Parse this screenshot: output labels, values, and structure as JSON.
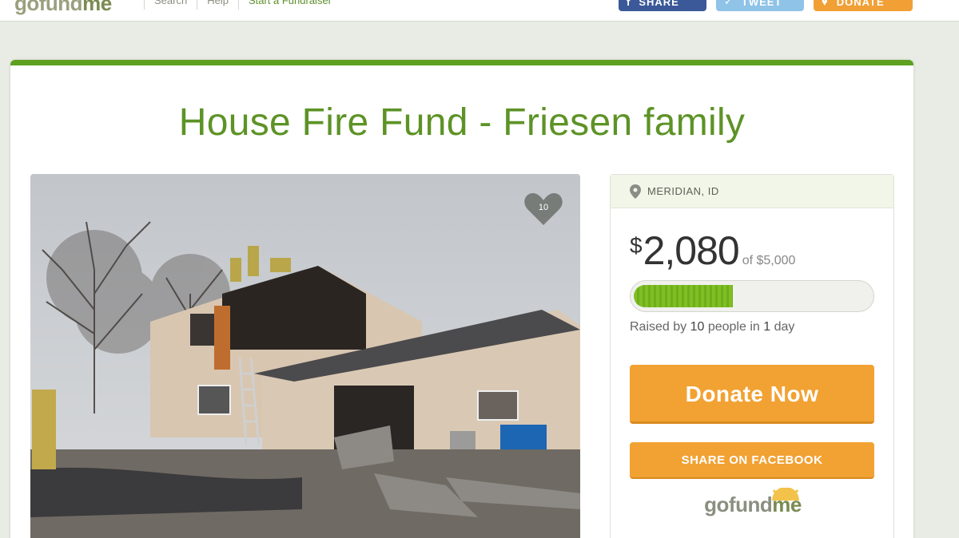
{
  "header": {
    "logo_prefix": "gofund",
    "logo_suffix": "me",
    "nav": [
      "Search",
      "Help",
      "Start a Fundraiser"
    ],
    "share_label": "SHARE",
    "tweet_label": "TWEET",
    "donate_label": "DONATE"
  },
  "campaign": {
    "title": "House Fire Fund - Friesen family",
    "likes": "10",
    "location": "MERIDIAN, ID",
    "currency": "$",
    "raised": "2,080",
    "goal_text": "of $5,000",
    "progress_fraction": 0.416,
    "raised_by_prefix": "Raised by ",
    "people_count": "10",
    "people_mid": " people in ",
    "days_count": "1",
    "days_suffix": " day",
    "donate_now_label": "Donate Now",
    "share_facebook_label": "SHARE ON FACEBOOK"
  },
  "footer_logo": {
    "prefix": "gofund",
    "suffix": "me"
  },
  "colors": {
    "brand_green": "#5d9326",
    "accent_orange": "#f1a233",
    "facebook_blue": "#3b5998",
    "twitter_blue": "#8fc3e8",
    "progress_green": "#7fbf24"
  },
  "icons": [
    "facebook-icon",
    "twitter-icon",
    "heart-icon",
    "map-pin-icon"
  ]
}
